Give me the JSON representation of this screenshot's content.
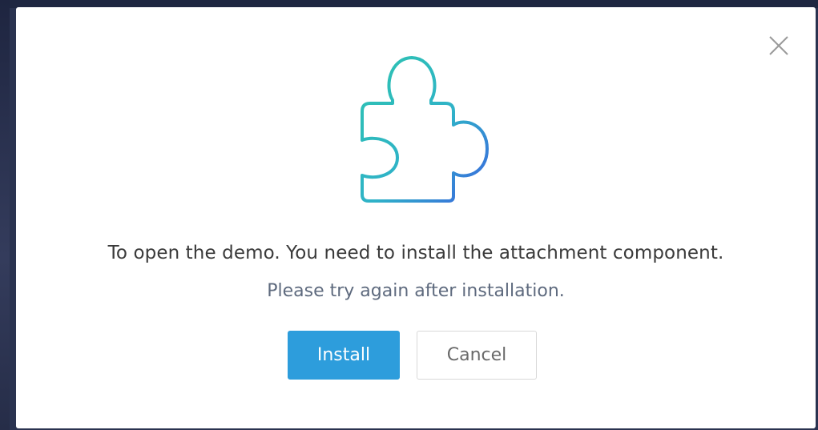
{
  "dialog": {
    "close_icon": "close-icon",
    "illustration_icon": "puzzle-piece-icon",
    "message": "To open the demo. You need to install the attachment component.",
    "submessage": "Please try again after installation.",
    "install_label": "Install",
    "cancel_label": "Cancel"
  },
  "colors": {
    "accent": "#2d9ddc",
    "puzzle_gradient_start": "#2ec4b0",
    "puzzle_gradient_end": "#3b63e0"
  }
}
